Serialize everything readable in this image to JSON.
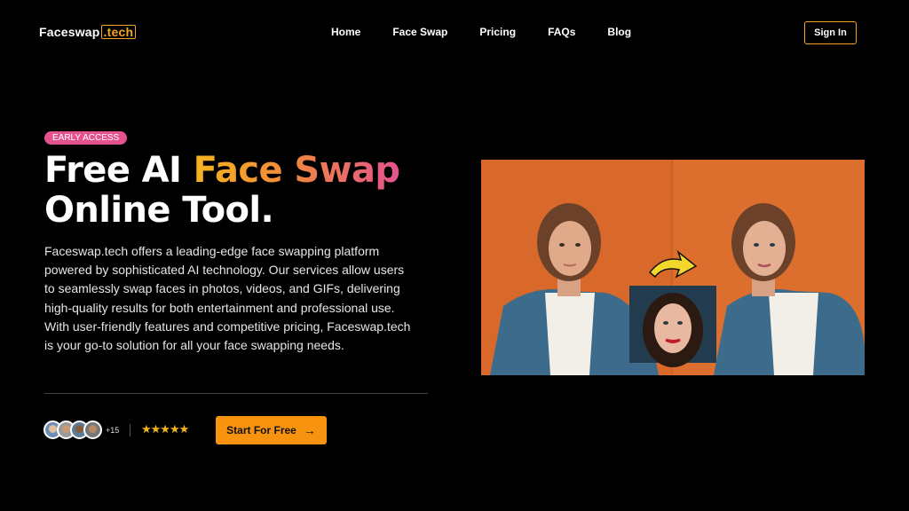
{
  "brand": {
    "name": "Faceswap",
    "domain": ".tech"
  },
  "nav": {
    "items": [
      "Home",
      "Face Swap",
      "Pricing",
      "FAQs",
      "Blog"
    ],
    "signin": "Sign In"
  },
  "hero": {
    "badge": "EARLY ACCESS",
    "title_line1_plain": "Free AI ",
    "title_line1_highlight": "Face Swap",
    "title_line2": "Online Tool.",
    "description": "Faceswap.tech offers a leading-edge face swapping platform powered by sophisticated AI technology. Our services allow users to seamlessly swap faces in photos, videos, and GIFs, delivering high-quality results for both entertainment and professional use. With user-friendly features and competitive pricing, Faceswap.tech is your go-to solution for all your face swapping needs.",
    "user_count": "+15",
    "stars": "★★★★★",
    "rating": 5,
    "cta": "Start For Free",
    "cta_icon": "arrow-right-icon"
  },
  "colors": {
    "accent": "#f7930e",
    "badge": "#e4538d",
    "background": "#000000"
  }
}
